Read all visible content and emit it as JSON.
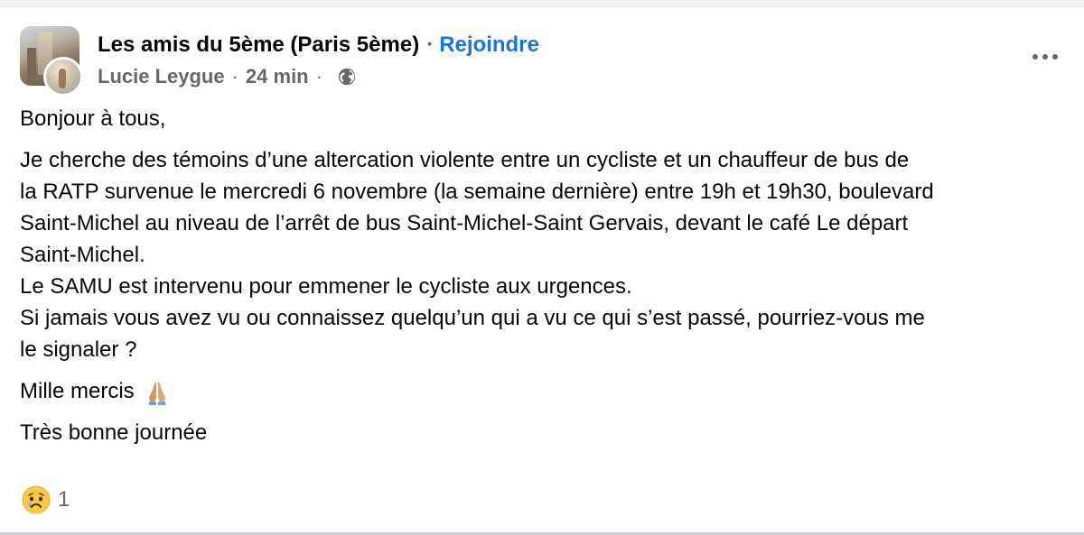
{
  "header": {
    "group_name": "Les amis du 5ème (Paris 5ème)",
    "separator": "·",
    "join_label": "Rejoindre",
    "author": "Lucie Leygue",
    "time": "24 min",
    "visibility_icon": "globe-icon",
    "more_icon": "more-options-icon"
  },
  "post": {
    "greeting": "Bonjour à tous,",
    "lines": [
      "Je cherche des témoins d’une altercation violente entre un cycliste et un chauffeur de bus de",
      "la RATP survenue le mercredi 6 novembre (la semaine dernière) entre 19h et 19h30, boulevard",
      "Saint-Michel au niveau de l’arrêt de bus Saint-Michel-Saint Gervais, devant le café Le départ",
      "Saint-Michel.",
      "Le SAMU est intervenu pour emmener le cycliste aux urgences.",
      "Si jamais vous avez vu ou connaissez quelqu’un qui a vu ce qui s’est passé, pourriez-vous me",
      "le signaler ?"
    ],
    "thanks": "Mille mercis",
    "thanks_emoji": "folded-hands-icon",
    "closing": "Très bonne journée"
  },
  "reactions": {
    "icon": "sad-face-icon",
    "count": "1"
  },
  "colors": {
    "link_blue": "#1b74e4",
    "meta_gray": "#65676b",
    "text": "#050505"
  }
}
